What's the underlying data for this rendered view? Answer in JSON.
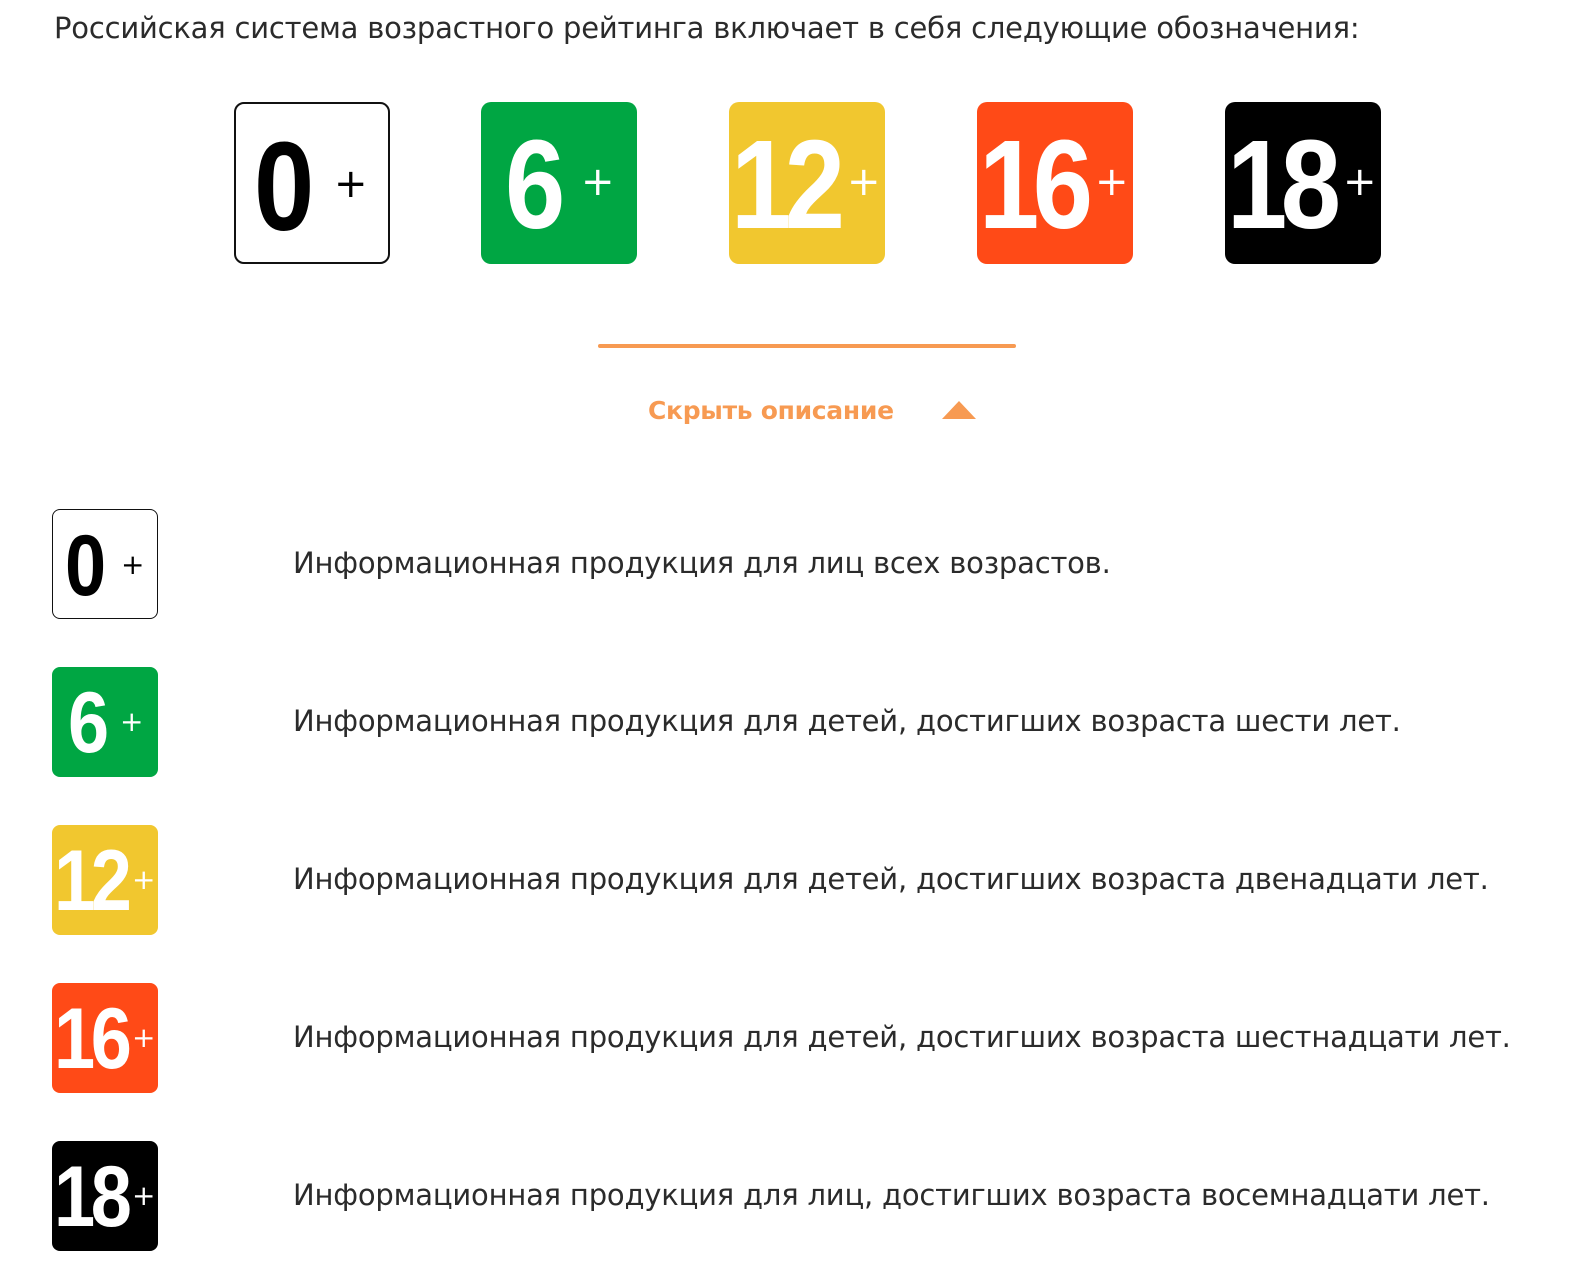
{
  "intro_text": "Российская система возрастного рейтинга включает в себя следующие обозначения:",
  "ratings": [
    {
      "number": "0",
      "plus": "+",
      "bg": "#ffffff",
      "fg": "#000000",
      "description": "Информационная продукция для лиц всех возрастов."
    },
    {
      "number": "6",
      "plus": "+",
      "bg": "#00a643",
      "fg": "#ffffff",
      "description": "Информационная продукция для детей, достигших возраста шести лет."
    },
    {
      "number": "12",
      "plus": "+",
      "bg": "#f1c72f",
      "fg": "#ffffff",
      "description": "Информационная продукция для детей, достигших возраста двенадцати лет."
    },
    {
      "number": "16",
      "plus": "+",
      "bg": "#ff4a17",
      "fg": "#ffffff",
      "description": "Информационная продукция для детей, достигших возраста шестнадцати лет."
    },
    {
      "number": "18",
      "plus": "+",
      "bg": "#000000",
      "fg": "#ffffff",
      "description": "Информационная продукция для лиц, достигших возраста восемнадцати лет."
    }
  ],
  "toggle": {
    "label": "Скрыть описание",
    "icon": "triangle-up-icon",
    "color": "#f79a52"
  },
  "divider_color": "#f79a52"
}
